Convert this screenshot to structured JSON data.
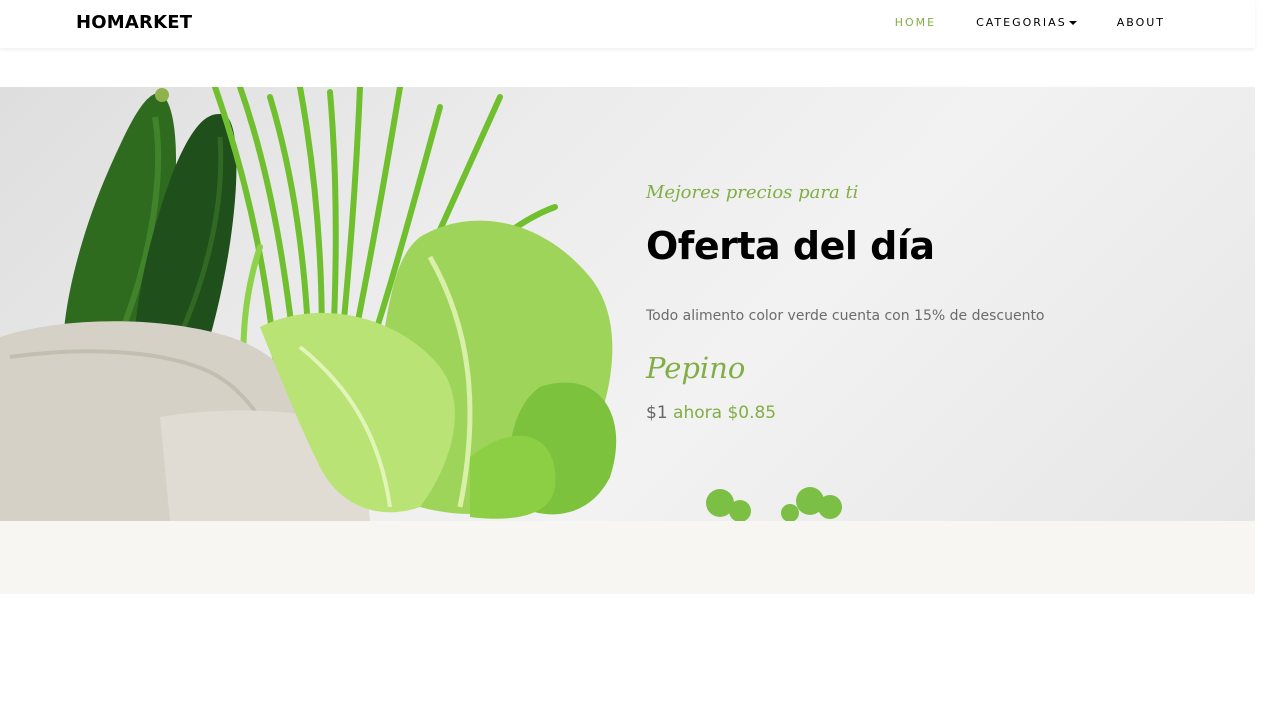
{
  "navbar": {
    "brand": "HOMARKET",
    "links": [
      {
        "label": "HOME",
        "active": true
      },
      {
        "label": "CATEGORIAS",
        "dropdown": true
      },
      {
        "label": "ABOUT"
      }
    ]
  },
  "hero": {
    "subheading": "Mejores precios para ti",
    "headline": "Oferta del día",
    "description": "Todo alimento color verde cuenta con 15% de descuento",
    "product_name": "Pepino",
    "price_old": "$1",
    "price_new": "ahora $0.85",
    "image_icon": "vegetables-photo"
  },
  "colors": {
    "accent": "#82ae46",
    "text_dark": "#000000",
    "text_muted": "#6b6b6b",
    "band_bg": "#f7f6f2"
  }
}
